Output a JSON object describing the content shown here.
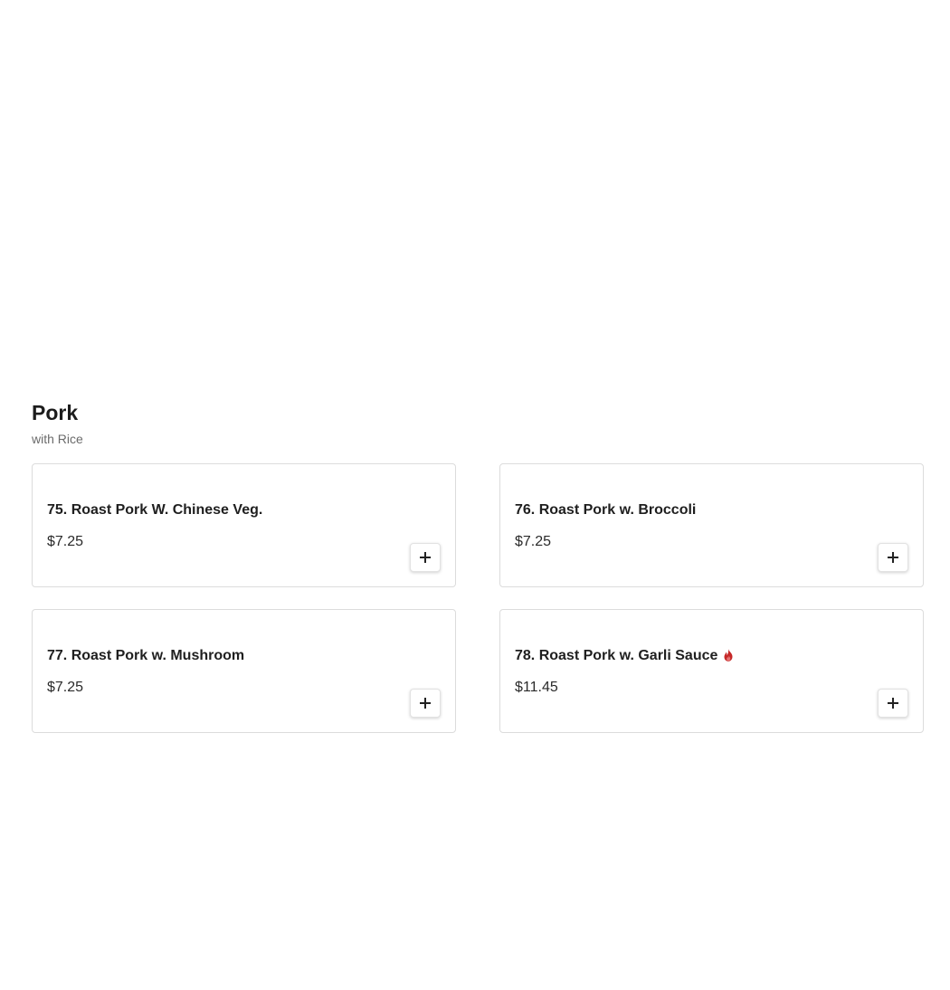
{
  "section": {
    "title": "Pork",
    "subtitle": "with Rice"
  },
  "items": [
    {
      "name": "75. Roast Pork W. Chinese Veg.",
      "price": "$7.25",
      "spicy": false
    },
    {
      "name": "76. Roast Pork w. Broccoli",
      "price": "$7.25",
      "spicy": false
    },
    {
      "name": "77. Roast Pork w. Mushroom",
      "price": "$7.25",
      "spicy": false
    },
    {
      "name": "78. Roast Pork w. Garli Sauce",
      "price": "$11.45",
      "spicy": true
    }
  ],
  "icons": {
    "add": "plus-icon",
    "spicy": "flame-icon"
  },
  "colors": {
    "spicy": "#c62828",
    "card_border": "#dcdcdc",
    "subtitle": "#6b6b6b"
  }
}
